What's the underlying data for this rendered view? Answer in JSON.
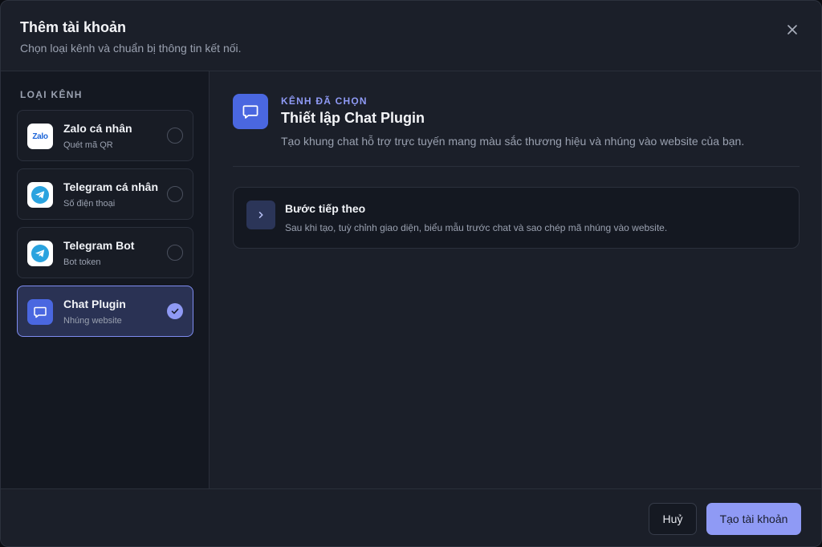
{
  "dialog": {
    "title": "Thêm tài khoản",
    "subtitle": "Chọn loại kênh và chuẩn bị thông tin kết nối."
  },
  "sidebar": {
    "heading": "LOẠI KÊNH",
    "channels": [
      {
        "name": "Zalo cá nhân",
        "desc": "Quét mã QR",
        "icon": "zalo-logo-icon",
        "selected": false,
        "logo_text": "Zalo"
      },
      {
        "name": "Telegram cá nhân",
        "desc": "Số điện thoại",
        "icon": "telegram-icon",
        "selected": false
      },
      {
        "name": "Telegram Bot",
        "desc": "Bot token",
        "icon": "telegram-icon",
        "selected": false
      },
      {
        "name": "Chat Plugin",
        "desc": "Nhúng website",
        "icon": "chat-bubble-icon",
        "selected": true
      }
    ]
  },
  "main": {
    "eyebrow": "KÊNH ĐÃ CHỌN",
    "title": "Thiết lập Chat Plugin",
    "description": "Tạo khung chat hỗ trợ trực tuyến mang màu sắc thương hiệu và nhúng vào website của bạn.",
    "next_step": {
      "title": "Bước tiếp theo",
      "description": "Sau khi tạo, tuỳ chỉnh giao diện, biểu mẫu trước chat và sao chép mã nhúng vào website."
    }
  },
  "footer": {
    "cancel_label": "Huỷ",
    "create_label": "Tạo tài khoản"
  },
  "colors": {
    "accent": "#8f9af5",
    "brand_blue": "#4a67e0",
    "telegram": "#2aa3df",
    "background": "#1b1f29"
  }
}
